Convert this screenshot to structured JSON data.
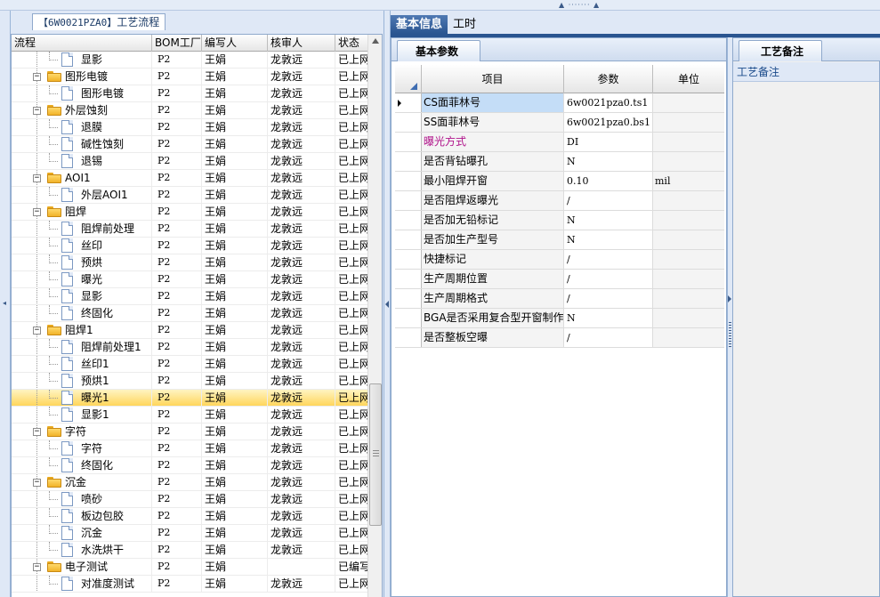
{
  "left_panel": {
    "tab_code": "【6W0021PZA0】",
    "tab_label": "工艺流程",
    "columns": [
      "流程",
      "BOM工厂",
      "编写人",
      "核审人",
      "状态"
    ],
    "rows": [
      {
        "level": 1,
        "type": "step",
        "name": "显影",
        "bom": "P2",
        "editor": "王娟",
        "reviewer": "龙敦远",
        "status": "已上网"
      },
      {
        "level": 0,
        "type": "group",
        "name": "图形电镀",
        "bom": "P2",
        "editor": "王娟",
        "reviewer": "龙敦远",
        "status": "已上网"
      },
      {
        "level": 1,
        "type": "step",
        "name": "图形电镀",
        "bom": "P2",
        "editor": "王娟",
        "reviewer": "龙敦远",
        "status": "已上网"
      },
      {
        "level": 0,
        "type": "group",
        "name": "外层蚀刻",
        "bom": "P2",
        "editor": "王娟",
        "reviewer": "龙敦远",
        "status": "已上网"
      },
      {
        "level": 1,
        "type": "step",
        "name": "退膜",
        "bom": "P2",
        "editor": "王娟",
        "reviewer": "龙敦远",
        "status": "已上网"
      },
      {
        "level": 1,
        "type": "step",
        "name": "碱性蚀刻",
        "bom": "P2",
        "editor": "王娟",
        "reviewer": "龙敦远",
        "status": "已上网"
      },
      {
        "level": 1,
        "type": "step",
        "name": "退锡",
        "bom": "P2",
        "editor": "王娟",
        "reviewer": "龙敦远",
        "status": "已上网"
      },
      {
        "level": 0,
        "type": "group",
        "name": "AOI1",
        "bom": "P2",
        "editor": "王娟",
        "reviewer": "龙敦远",
        "status": "已上网"
      },
      {
        "level": 1,
        "type": "step",
        "name": "外层AOI1",
        "bom": "P2",
        "editor": "王娟",
        "reviewer": "龙敦远",
        "status": "已上网"
      },
      {
        "level": 0,
        "type": "group",
        "name": "阻焊",
        "bom": "P2",
        "editor": "王娟",
        "reviewer": "龙敦远",
        "status": "已上网"
      },
      {
        "level": 1,
        "type": "step",
        "name": "阻焊前处理",
        "bom": "P2",
        "editor": "王娟",
        "reviewer": "龙敦远",
        "status": "已上网"
      },
      {
        "level": 1,
        "type": "step",
        "name": "丝印",
        "bom": "P2",
        "editor": "王娟",
        "reviewer": "龙敦远",
        "status": "已上网"
      },
      {
        "level": 1,
        "type": "step",
        "name": "预烘",
        "bom": "P2",
        "editor": "王娟",
        "reviewer": "龙敦远",
        "status": "已上网"
      },
      {
        "level": 1,
        "type": "step",
        "name": "曝光",
        "bom": "P2",
        "editor": "王娟",
        "reviewer": "龙敦远",
        "status": "已上网"
      },
      {
        "level": 1,
        "type": "step",
        "name": "显影",
        "bom": "P2",
        "editor": "王娟",
        "reviewer": "龙敦远",
        "status": "已上网"
      },
      {
        "level": 1,
        "type": "step",
        "name": "终固化",
        "bom": "P2",
        "editor": "王娟",
        "reviewer": "龙敦远",
        "status": "已上网"
      },
      {
        "level": 0,
        "type": "group",
        "name": "阻焊1",
        "bom": "P2",
        "editor": "王娟",
        "reviewer": "龙敦远",
        "status": "已上网"
      },
      {
        "level": 1,
        "type": "step",
        "name": "阻焊前处理1",
        "bom": "P2",
        "editor": "王娟",
        "reviewer": "龙敦远",
        "status": "已上网"
      },
      {
        "level": 1,
        "type": "step",
        "name": "丝印1",
        "bom": "P2",
        "editor": "王娟",
        "reviewer": "龙敦远",
        "status": "已上网"
      },
      {
        "level": 1,
        "type": "step",
        "name": "预烘1",
        "bom": "P2",
        "editor": "王娟",
        "reviewer": "龙敦远",
        "status": "已上网"
      },
      {
        "level": 1,
        "type": "step",
        "name": "曝光1",
        "bom": "P2",
        "editor": "王娟",
        "reviewer": "龙敦远",
        "status": "已上网",
        "selected": true
      },
      {
        "level": 1,
        "type": "step",
        "name": "显影1",
        "bom": "P2",
        "editor": "王娟",
        "reviewer": "龙敦远",
        "status": "已上网"
      },
      {
        "level": 0,
        "type": "group",
        "name": "字符",
        "bom": "P2",
        "editor": "王娟",
        "reviewer": "龙敦远",
        "status": "已上网"
      },
      {
        "level": 1,
        "type": "step",
        "name": "字符",
        "bom": "P2",
        "editor": "王娟",
        "reviewer": "龙敦远",
        "status": "已上网"
      },
      {
        "level": 1,
        "type": "step",
        "name": "终固化",
        "bom": "P2",
        "editor": "王娟",
        "reviewer": "龙敦远",
        "status": "已上网"
      },
      {
        "level": 0,
        "type": "group",
        "name": "沉金",
        "bom": "P2",
        "editor": "王娟",
        "reviewer": "龙敦远",
        "status": "已上网"
      },
      {
        "level": 1,
        "type": "step",
        "name": "喷砂",
        "bom": "P2",
        "editor": "王娟",
        "reviewer": "龙敦远",
        "status": "已上网"
      },
      {
        "level": 1,
        "type": "step",
        "name": "板边包胶",
        "bom": "P2",
        "editor": "王娟",
        "reviewer": "龙敦远",
        "status": "已上网"
      },
      {
        "level": 1,
        "type": "step",
        "name": "沉金",
        "bom": "P2",
        "editor": "王娟",
        "reviewer": "龙敦远",
        "status": "已上网"
      },
      {
        "level": 1,
        "type": "step",
        "name": "水洗烘干",
        "bom": "P2",
        "editor": "王娟",
        "reviewer": "龙敦远",
        "status": "已上网"
      },
      {
        "level": 0,
        "type": "group",
        "name": "电子测试",
        "bom": "P2",
        "editor": "王娟",
        "reviewer": "",
        "status": "已编写"
      },
      {
        "level": 1,
        "type": "step",
        "name": "对准度测试",
        "bom": "P2",
        "editor": "王娟",
        "reviewer": "龙敦远",
        "status": "已上网"
      }
    ]
  },
  "right_panel": {
    "main_tabs": [
      {
        "label": "基本信息",
        "active": true
      },
      {
        "label": "工时",
        "active": false
      }
    ],
    "params_tab": "基本参数",
    "param_columns": [
      "项目",
      "参数",
      "单位"
    ],
    "params": [
      {
        "item": "CS面菲林号",
        "value": "6w0021pza0.ts1",
        "unit": "",
        "current": true
      },
      {
        "item": "SS面菲林号",
        "value": "6w0021pza0.bs1",
        "unit": ""
      },
      {
        "item": "曝光方式",
        "value": "DI",
        "unit": "",
        "accent": true
      },
      {
        "item": "是否背钻曝孔",
        "value": "N",
        "unit": ""
      },
      {
        "item": "最小阻焊开窗",
        "value": "0.10",
        "unit": "mil"
      },
      {
        "item": "是否阻焊返曝光",
        "value": "/",
        "unit": ""
      },
      {
        "item": "是否加无铅标记",
        "value": "N",
        "unit": ""
      },
      {
        "item": "是否加生产型号",
        "value": "N",
        "unit": ""
      },
      {
        "item": "快捷标记",
        "value": "/",
        "unit": ""
      },
      {
        "item": "生产周期位置",
        "value": "/",
        "unit": ""
      },
      {
        "item": "生产周期格式",
        "value": "/",
        "unit": ""
      },
      {
        "item": "BGA是否采用复合型开窗制作",
        "value": "N",
        "unit": ""
      },
      {
        "item": "是否整板空曝",
        "value": "/",
        "unit": ""
      }
    ],
    "notes_tab": "工艺备注",
    "notes_label": "工艺备注"
  },
  "colors": {
    "accent_blue": "#2a5590",
    "selection_gold": "#ffd65c",
    "accent_magenta": "#b0128a"
  }
}
